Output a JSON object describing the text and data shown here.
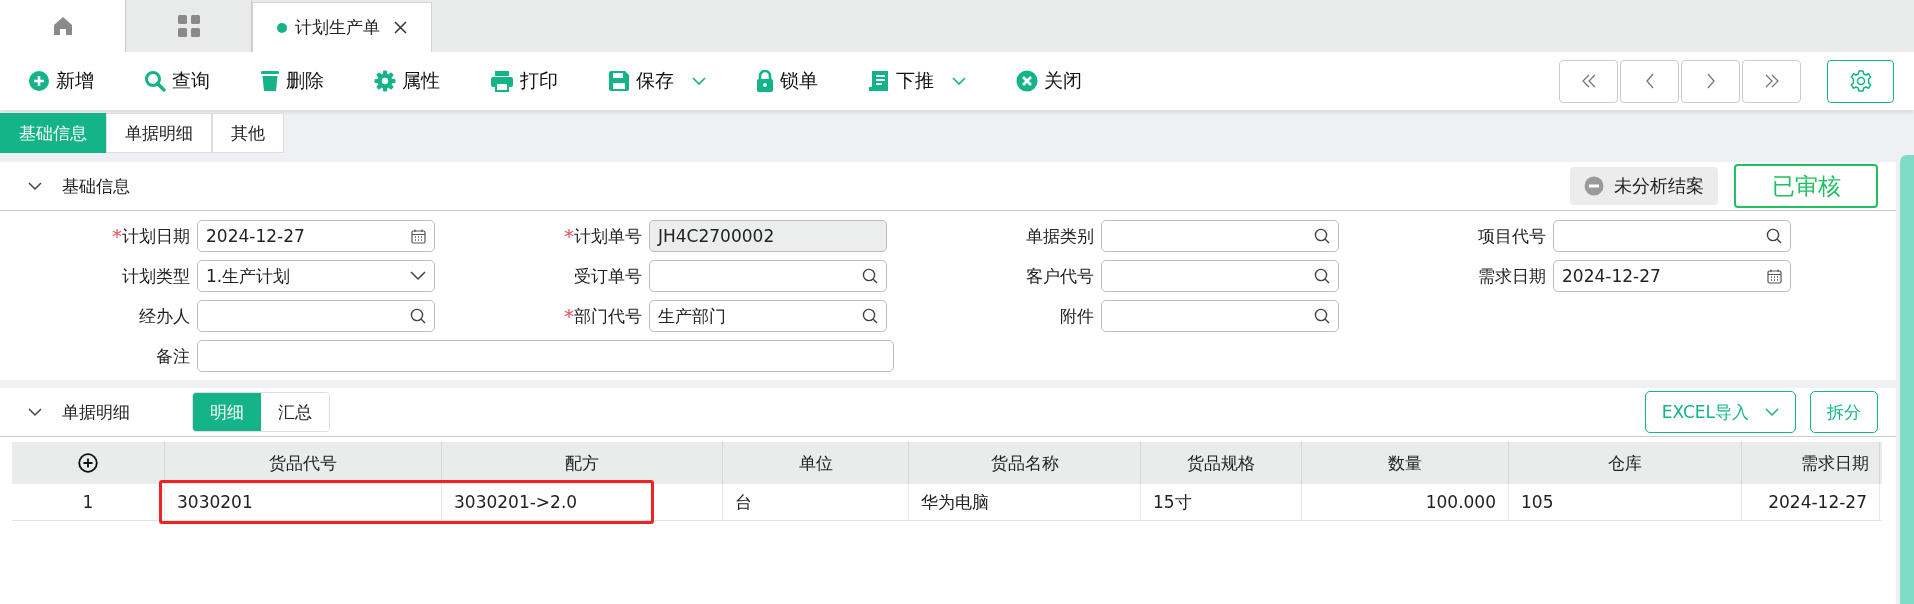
{
  "page_tabs": [
    {
      "kind": "home"
    },
    {
      "kind": "apps"
    },
    {
      "kind": "doc",
      "label": "计划生产单"
    }
  ],
  "toolbar": [
    {
      "label": "新增",
      "kind": "button"
    },
    {
      "label": "查询",
      "kind": "button"
    },
    {
      "label": "删除",
      "kind": "button"
    },
    {
      "label": "属性",
      "kind": "button"
    },
    {
      "label": "打印",
      "kind": "button"
    },
    {
      "label": "保存",
      "kind": "dropdown"
    },
    {
      "label": "锁单",
      "kind": "button"
    },
    {
      "label": "下推",
      "kind": "dropdown"
    },
    {
      "label": "关闭",
      "kind": "button"
    }
  ],
  "form_tabs": [
    {
      "label": "基础信息",
      "selected": true
    },
    {
      "label": "单据明细",
      "selected": false
    },
    {
      "label": "其他",
      "selected": false
    }
  ],
  "basic": {
    "title": "基础信息",
    "expanded": true,
    "close_status": "未分析结案",
    "approval_stamp": "已审核",
    "rows": [
      [
        {
          "label": "计划日期",
          "required_mark": "*",
          "kind": "date",
          "value": "2024-12-27"
        },
        {
          "label": "计划单号",
          "required_mark": "*",
          "kind": "text",
          "disabled": true,
          "value": "JH4C2700002"
        },
        {
          "label": "单据类别",
          "kind": "lookup"
        },
        {
          "label": "项目代号",
          "kind": "lookup"
        }
      ],
      [
        {
          "label": "计划类型",
          "kind": "select",
          "value": "1.生产计划"
        },
        {
          "label": "受订单号",
          "kind": "lookup"
        },
        {
          "label": "客户代号",
          "kind": "lookup"
        },
        {
          "label": "需求日期",
          "kind": "date",
          "value": "2024-12-27"
        }
      ],
      [
        {
          "label": "经办人",
          "kind": "lookup"
        },
        {
          "label": "部门代号",
          "required_mark": "*",
          "kind": "lookup",
          "value": "生产部门"
        },
        {
          "label": "附件",
          "kind": "lookup"
        }
      ],
      [
        {
          "label": "备注",
          "kind": "wide"
        }
      ]
    ]
  },
  "detail": {
    "title": "单据明细",
    "expanded": true,
    "views": [
      {
        "label": "明细",
        "selected": true
      },
      {
        "label": "汇总",
        "selected": false
      }
    ],
    "import_button": "EXCEL导入",
    "split_button": "拆分",
    "table": {
      "columns": [
        "货品代号",
        "配方",
        "单位",
        "货品名称",
        "货品规格",
        "数量",
        "仓库",
        "需求日期"
      ],
      "rows": [
        {
          "highlighted": true,
          "number": "1",
          "cells": [
            "3030201",
            "3030201->2.0",
            "台",
            "华为电脑",
            "15寸",
            "100.000",
            "105",
            "2024-12-27"
          ]
        }
      ]
    }
  }
}
